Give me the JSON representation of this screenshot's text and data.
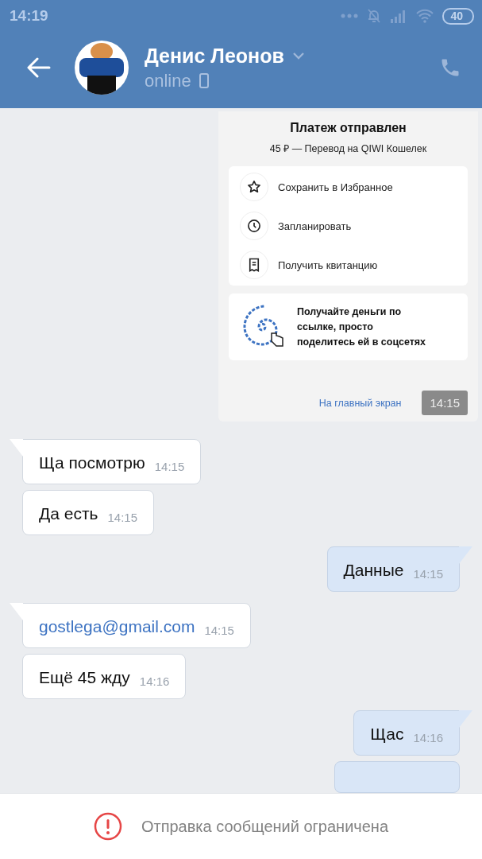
{
  "status_bar": {
    "time": "14:19",
    "battery": "40"
  },
  "header": {
    "name": "Денис Леонов",
    "status": "online"
  },
  "payment_card": {
    "title": "Платеж отправлен",
    "subtitle": "45 ₽ — Перевод на QIWI Кошелек",
    "actions": [
      {
        "kind": "star",
        "label": "Сохранить в Избранное"
      },
      {
        "kind": "clock",
        "label": "Запланировать"
      },
      {
        "kind": "receipt",
        "label": "Получить квитанцию"
      }
    ],
    "promo": "Получайте деньги по ссылке, просто поделитесь ей в соцсетях",
    "home_link": "На главный экран",
    "time": "14:15"
  },
  "messages": [
    {
      "outgoing": false,
      "kind": "text",
      "tail": true,
      "text": "Ща посмотрю",
      "time": "14:15"
    },
    {
      "outgoing": false,
      "kind": "text",
      "tail": false,
      "text": "Да есть",
      "time": "14:15"
    },
    {
      "outgoing": true,
      "kind": "text",
      "tail": true,
      "text": "Данные",
      "time": "14:15"
    },
    {
      "outgoing": false,
      "kind": "link",
      "tail": true,
      "text": "gostlega@gmail.com",
      "time": "14:15"
    },
    {
      "outgoing": false,
      "kind": "text",
      "tail": false,
      "text": "Ещё 45 жду",
      "time": "14:16"
    },
    {
      "outgoing": true,
      "kind": "text",
      "tail": true,
      "text": "Щас",
      "time": "14:16"
    },
    {
      "outgoing": true,
      "kind": "cut",
      "tail": false
    }
  ],
  "bottom_bar": {
    "notice": "Отправка сообщений ограничена"
  }
}
